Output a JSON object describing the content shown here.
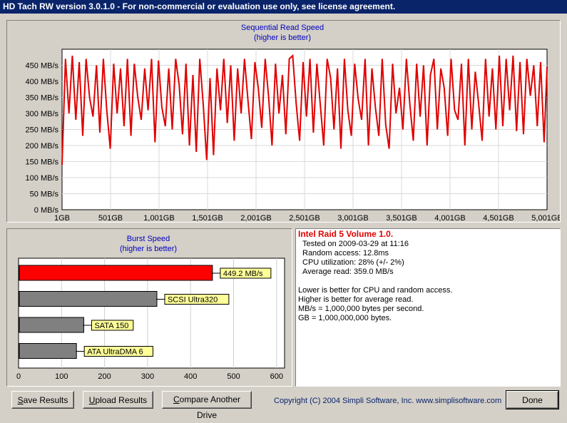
{
  "window": {
    "title": "HD Tach RW version 3.0.1.0  -  For non-commercial or evaluation use only, see license agreement."
  },
  "seq_chart": {
    "title": "Sequential Read Speed",
    "subtitle": "(higher is better)",
    "y_ticks": [
      "0 MB/s",
      "50 MB/s",
      "100 MB/s",
      "150 MB/s",
      "200 MB/s",
      "250 MB/s",
      "300 MB/s",
      "350 MB/s",
      "400 MB/s",
      "450 MB/s"
    ],
    "x_ticks": [
      "1GB",
      "501GB",
      "1,001GB",
      "1,501GB",
      "2,001GB",
      "2,501GB",
      "3,001GB",
      "3,501GB",
      "4,001GB",
      "4,501GB",
      "5,001GB"
    ],
    "line_color": "#e00000"
  },
  "burst_chart": {
    "title": "Burst Speed",
    "subtitle": "(higher is better)",
    "x_ticks": [
      "0",
      "100",
      "200",
      "300",
      "400",
      "500",
      "600"
    ],
    "bars": [
      {
        "label": "449.2 MB/s",
        "value": 449.2,
        "color": "#ff0000"
      },
      {
        "label": "SCSI Ultra320",
        "value": 320,
        "color": "#808080"
      },
      {
        "label": "SATA 150",
        "value": 150,
        "color": "#808080"
      },
      {
        "label": "ATA UltraDMA 6",
        "value": 133,
        "color": "#808080"
      }
    ]
  },
  "chart_data": [
    {
      "type": "line",
      "title": "Sequential Read Speed",
      "subtitle": "(higher is better)",
      "ylabel": "",
      "xlabel": "",
      "ylim": [
        0,
        500
      ],
      "xlim": [
        1,
        5001
      ],
      "x_unit": "GB",
      "y_unit": "MB/s",
      "series": [
        {
          "color": "#e00000",
          "x": [
            1,
            36,
            72,
            107,
            143,
            178,
            214,
            249,
            285,
            320,
            356,
            391,
            427,
            462,
            498,
            533,
            569,
            604,
            640,
            675,
            711,
            746,
            782,
            817,
            853,
            888,
            924,
            959,
            995,
            1030,
            1066,
            1101,
            1137,
            1172,
            1208,
            1243,
            1279,
            1314,
            1350,
            1385,
            1421,
            1456,
            1492,
            1527,
            1563,
            1598,
            1634,
            1669,
            1705,
            1740,
            1776,
            1811,
            1847,
            1882,
            1918,
            1953,
            1989,
            2024,
            2060,
            2095,
            2131,
            2166,
            2202,
            2237,
            2273,
            2308,
            2344,
            2379,
            2415,
            2450,
            2486,
            2521,
            2557,
            2592,
            2628,
            2663,
            2699,
            2734,
            2770,
            2805,
            2841,
            2876,
            2912,
            2947,
            2983,
            3018,
            3054,
            3089,
            3125,
            3160,
            3196,
            3231,
            3267,
            3302,
            3338,
            3373,
            3409,
            3444,
            3480,
            3515,
            3551,
            3586,
            3622,
            3657,
            3693,
            3728,
            3764,
            3799,
            3835,
            3870,
            3906,
            3941,
            3977,
            4012,
            4048,
            4083,
            4119,
            4154,
            4190,
            4225,
            4261,
            4296,
            4332,
            4367,
            4403,
            4438,
            4474,
            4509,
            4545,
            4580,
            4616,
            4651,
            4687,
            4722,
            4758,
            4793,
            4829,
            4864,
            4900,
            4935,
            4971,
            5001
          ],
          "y": [
            140,
            470,
            300,
            480,
            280,
            460,
            230,
            470,
            350,
            290,
            450,
            240,
            470,
            310,
            190,
            455,
            300,
            440,
            260,
            470,
            230,
            455,
            350,
            280,
            440,
            310,
            470,
            210,
            465,
            320,
            260,
            440,
            250,
            470,
            390,
            235,
            455,
            200,
            420,
            180,
            470,
            330,
            155,
            410,
            170,
            440,
            310,
            470,
            270,
            450,
            215,
            440,
            300,
            470,
            340,
            220,
            460,
            380,
            255,
            470,
            350,
            200,
            455,
            300,
            420,
            235,
            470,
            480,
            330,
            215,
            460,
            290,
            470,
            240,
            455,
            330,
            200,
            470,
            410,
            250,
            440,
            190,
            470,
            310,
            230,
            455,
            345,
            280,
            470,
            200,
            440,
            320,
            230,
            470,
            265,
            190,
            455,
            300,
            380,
            250,
            470,
            330,
            215,
            455,
            290,
            450,
            200,
            420,
            470,
            250,
            440,
            380,
            230,
            470,
            310,
            280,
            455,
            200,
            470,
            250,
            430,
            330,
            215,
            470,
            290,
            440,
            250,
            480,
            260,
            470,
            310,
            480,
            245,
            460,
            235,
            470,
            355,
            450,
            260,
            460,
            210,
            445
          ]
        }
      ]
    },
    {
      "type": "bar",
      "title": "Burst Speed",
      "subtitle": "(higher is better)",
      "categories": [
        "449.2 MB/s",
        "SCSI Ultra320",
        "SATA 150",
        "ATA UltraDMA 6"
      ],
      "values": [
        449.2,
        320,
        150,
        133
      ],
      "xlim": [
        0,
        600
      ]
    }
  ],
  "info": {
    "title": "Intel Raid 5 Volume 1.0.",
    "lines": [
      "Tested on 2009-03-29 at 11:16",
      "Random access: 12.8ms",
      "CPU utilization: 28% (+/- 2%)",
      "Average read: 359.0 MB/s"
    ],
    "notes": [
      "Lower is better for CPU and random access.",
      "Higher is better for average read.",
      "MB/s = 1,000,000 bytes per second.",
      "GB = 1,000,000,000 bytes."
    ]
  },
  "buttons": {
    "save": {
      "hotkey": "S",
      "rest": "ave Results"
    },
    "upload": {
      "hotkey": "U",
      "rest": "pload Results"
    },
    "compare": {
      "hotkey": "C",
      "rest": "ompare Another Drive"
    },
    "done": "Done"
  },
  "copyright": "Copyright (C) 2004 Simpli Software, Inc. www.simplisoftware.com"
}
